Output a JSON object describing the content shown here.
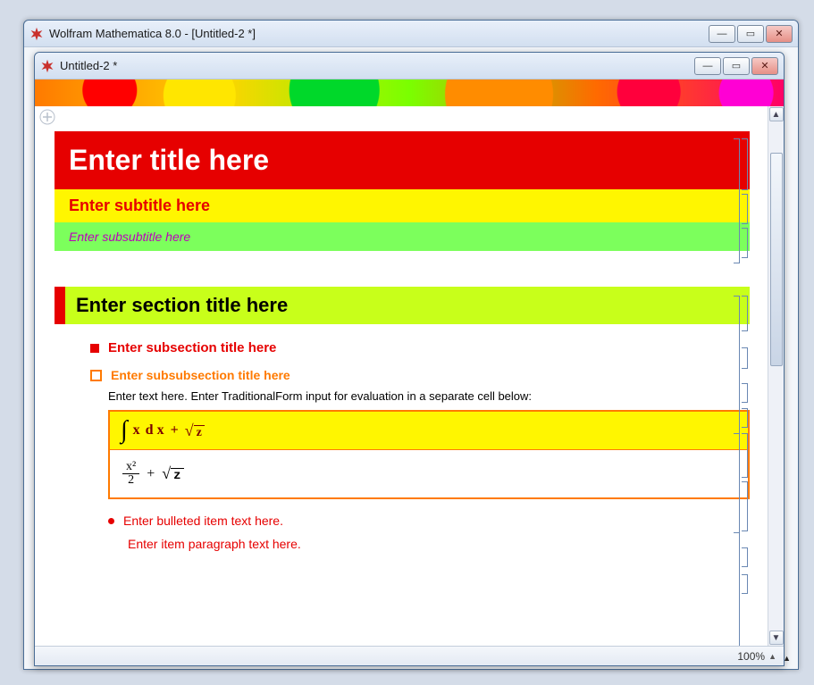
{
  "outer": {
    "title": "Wolfram Mathematica 8.0 - [Untitled-2 *]",
    "zoom": "100%"
  },
  "inner": {
    "title": "Untitled-2 *",
    "zoom": "100%"
  },
  "notebook": {
    "title": "Enter title here",
    "subtitle": "Enter subtitle here",
    "subsubtitle": "Enter subsubtitle here",
    "section": "Enter section title here",
    "subsection": "Enter subsection title here",
    "subsubsection": "Enter subsubsection title here",
    "text": "Enter text here. Enter TraditionalForm input for evaluation in a separate cell below:",
    "input_expr": {
      "int_var": "x",
      "dvar": "d x",
      "plus": "+",
      "sqrt_arg": "z"
    },
    "output_expr": {
      "num": "x²",
      "den": "2",
      "plus": "+",
      "sqrt_arg": "z"
    },
    "bulleted": "Enter bulleted item text here.",
    "item_para": "Enter item paragraph text here."
  },
  "icons": {
    "minimize": "—",
    "maximize": "▭",
    "close": "✕",
    "up": "▲",
    "down": "▼"
  }
}
